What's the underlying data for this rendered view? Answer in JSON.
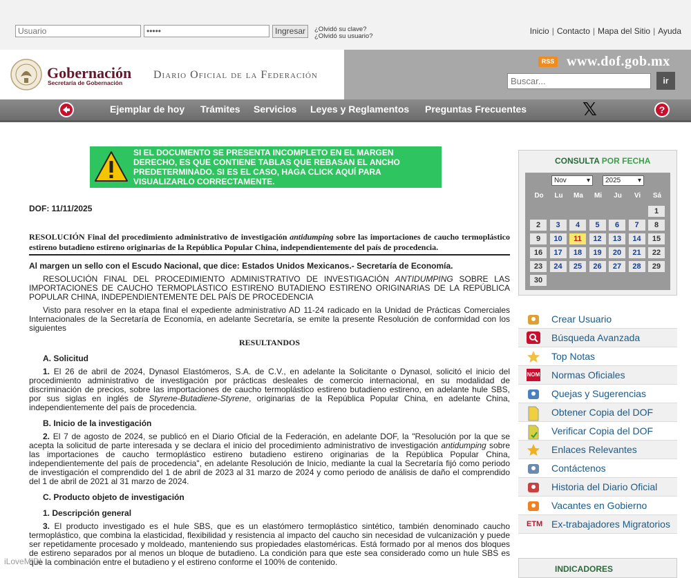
{
  "top": {
    "user_placeholder": "Usuario",
    "pass_value": "•••••",
    "login_label": "Ingresar",
    "forgot_key": "¿Olvidó su clave?",
    "forgot_user": "¿Olvidó su usuario?",
    "links": [
      "Inicio",
      "Contacto",
      "Mapa del Sitio",
      "Ayuda"
    ]
  },
  "header": {
    "gob_title": "Gobernación",
    "gob_sub": "Secretaría de Gobernación",
    "dof_title": "Diario Oficial de la Federación",
    "rss": "RSS",
    "site": "www.dof.gob.mx",
    "search_placeholder": "Buscar...",
    "search_btn": "ir"
  },
  "nav": {
    "items": [
      "Ejemplar de hoy",
      "Trámites",
      "Servicios",
      "Leyes y Reglamentos",
      "Preguntas Frecuentes"
    ]
  },
  "notice": "SI EL DOCUMENTO SE PRESENTA INCOMPLETO EN EL MARGEN DERECHO, ES QUE CONTIENE TABLAS QUE REBASAN EL ANCHO PREDETERMINADO. SI ES EL CASO, HAGA CLICK AQUÍ PARA VISUALIZARLO CORRECTAMENTE.",
  "doc": {
    "date": "DOF: 11/11/2025",
    "title_pre": "RESOLUCIÓN Final del procedimiento administrativo de investigación ",
    "title_ital": "antidumping",
    "title_post": " sobre las importaciones de caucho termoplástico estireno butadieno estireno originarias de la República Popular China, independientemente del país de procedencia.",
    "seal_line": "Al margen un sello con el Escudo Nacional, que dice: Estados Unidos Mexicanos.- Secretaría de Economía.",
    "p1_pre": "RESOLUCIÓN FINAL DEL PROCEDIMIENTO ADMINISTRATIVO DE INVESTIGACIÓN ",
    "p1_ital": "ANTIDUMPING",
    "p1_post": " SOBRE LAS IMPORTACIONES DE CAUCHO TERMOPLÁSTICO ESTIRENO BUTADIENO ESTIRENO ORIGINARIAS DE LA REPÚBLICA POPULAR CHINA, INDEPENDIENTEMENTE DEL PAÍS DE PROCEDENCIA",
    "p2": "Visto para resolver en la etapa final el expediente administrativo AD 11-24 radicado en la Unidad de Prácticas Comerciales Internacionales de la Secretaría de Economía, en adelante Secretaría, se emite la presente Resolución de conformidad con los siguientes",
    "resultandos": "RESULTANDOS",
    "secA": "A. Solicitud",
    "p3_num": "1.",
    "p3_pre": " El 26 de abril de 2024, Dynasol Elastómeros, S.A. de C.V., en adelante la Solicitante o Dynasol, solicitó el inicio del procedimiento administrativo de investigación por prácticas desleales de comercio internacional, en su modalidad de discriminación de precios, sobre las importaciones de caucho termoplástico estireno butadieno estireno, en adelante hule SBS, por sus siglas en inglés de ",
    "p3_ital": "Styrene-Butadiene-Styrene",
    "p3_post": ", originarias de la República Popular China, en adelante China, independientemente del país de procedencia.",
    "secB": "B. Inicio de la investigación",
    "p4_num": "2.",
    "p4_pre": " El 7 de agosto de 2024, se publicó en el Diario Oficial de la Federación, en adelante DOF, la \"Resolución por la que se acepta la solicitud de parte interesada y se declara el inicio del procedimiento administrativo de investigación ",
    "p4_ital": "antidumping",
    "p4_post": " sobre las importaciones de caucho termoplástico estireno butadieno estireno originarias de la República Popular China, independientemente del país de procedencia\", en adelante Resolución de Inicio, mediante la cual la Secretaría fijó como periodo de investigación el comprendido del 1 de abril de 2023 al 31 marzo de 2024 y como periodo de análisis de daño el comprendido del 1 de abril de 2021 al 31 marzo de 2024.",
    "secC": "C. Producto objeto de investigación",
    "secC1": "1. Descripción general",
    "p5_num": "3.",
    "p5_text": " El producto investigado es el hule SBS, que es un elastómero termoplástico sintético, también denominado caucho termoplástico, que combina la elasticidad, flexibilidad y resistencia al impacto del caucho sin necesidad de vulcanización y puede ser repetidamente procesado y moldeado, manteniendo sus propiedades elastoméricas. Está formado por al menos dos bloques de estireno separados por al menos un bloque de butadieno. La condición para que este sea considerado como un hule SBS es que la combinación entre el butadieno y el estireno conforme el 100% de contenido."
  },
  "calendar": {
    "head_a": "CONSULTA",
    "head_b": " POR FECHA",
    "month": "Nov",
    "year": "2025",
    "dow": [
      "Do",
      "Lu",
      "Ma",
      "Mi",
      "Ju",
      "Vi",
      "Sá"
    ],
    "days": [
      "1",
      "2",
      "3",
      "4",
      "5",
      "6",
      "7",
      "8",
      "9",
      "10",
      "11",
      "12",
      "13",
      "14",
      "15",
      "16",
      "17",
      "18",
      "19",
      "20",
      "21",
      "22",
      "23",
      "24",
      "25",
      "26",
      "27",
      "28",
      "29",
      "30"
    ],
    "today": "11"
  },
  "side_links": [
    "Crear Usuario",
    "Búsqueda Avanzada",
    "Top Notas",
    "Normas Oficiales",
    "Quejas y Sugerencias",
    "Obtener Copia del DOF",
    "Verificar Copia del DOF",
    "Enlaces Relevantes",
    "Contáctenos",
    "Historia del Diario Oficial",
    "Vacantes en Gobierno",
    "Ex-trabajadores Migratorios"
  ],
  "icon_text": {
    "nom": "NOM",
    "etm": "ETM"
  },
  "indicadores": "INDICADORES",
  "watermark": "iLoveMIDI"
}
